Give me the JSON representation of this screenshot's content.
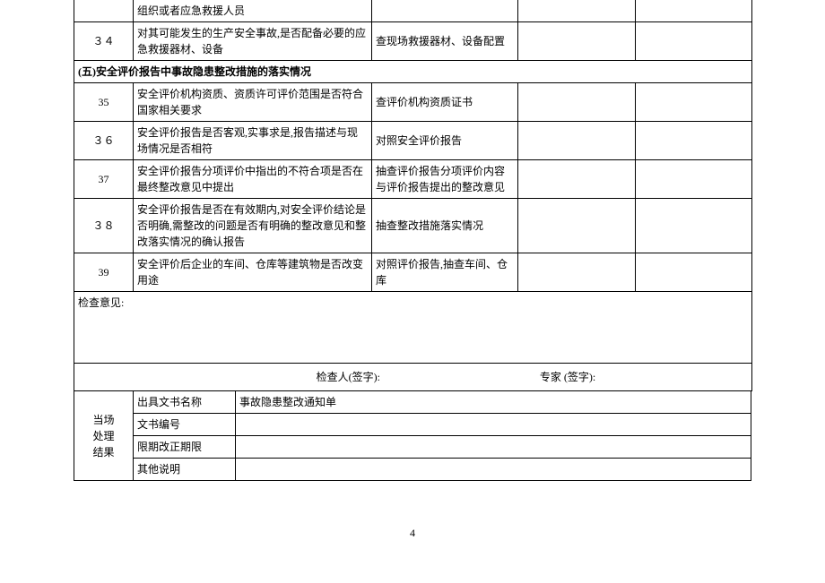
{
  "rows": [
    {
      "num": "",
      "desc": "组织或者应急救援人员",
      "method": ""
    },
    {
      "num": "３４",
      "desc": "对其可能发生的生产安全事故,是否配备必要的应急救援器材、设备",
      "method": "查现场救援器材、设备配置"
    }
  ],
  "section5_header": "(五)安全评价报告中事故隐患整改措施的落实情况",
  "section5_rows": [
    {
      "num": "35",
      "desc": "安全评价机构资质、资质许可评价范围是否符合国家相关要求",
      "method": "查评价机构资质证书"
    },
    {
      "num": "３６",
      "desc": "安全评价报告是否客观,实事求是,报告描述与现场情况是否相符",
      "method": "对照安全评价报告"
    },
    {
      "num": "37",
      "desc": "安全评价报告分项评价中指出的不符合项是否在最终整改意见中提出",
      "method": "抽查评价报告分项评价内容与评价报告提出的整改意见"
    },
    {
      "num": "３８",
      "desc": "安全评价报告是否在有效期内,对安全评价结论是否明确,需整改的问题是否有明确的整改意见和整改落实情况的确认报告",
      "method": "抽查整改措施落实情况"
    },
    {
      "num": "39",
      "desc": "安全评价后企业的车间、仓库等建筑物是否改变用途",
      "method": "对照评价报告,抽查车间、仓库"
    }
  ],
  "opinion_label": "检查意见:",
  "sign_inspector": "检查人(签字):",
  "sign_expert": "专家 (签字):",
  "result_block": {
    "label": "当场\n处理\n结果",
    "rows": [
      {
        "label": "出具文书名称",
        "value": "事故隐患整改通知单"
      },
      {
        "label": "文书编号",
        "value": ""
      },
      {
        "label": "限期改正期限",
        "value": ""
      },
      {
        "label": "其他说明",
        "value": ""
      }
    ]
  },
  "page_number": "4"
}
